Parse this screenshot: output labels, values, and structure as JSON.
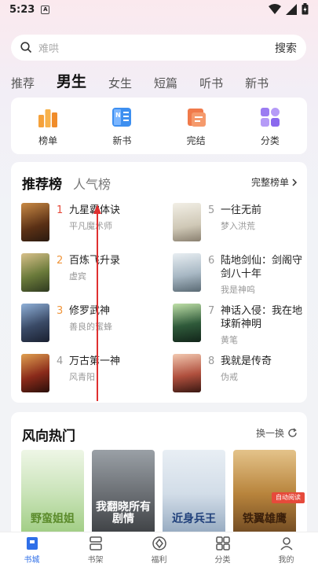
{
  "status": {
    "time": "5:23",
    "notif_badge": "A"
  },
  "search": {
    "placeholder": "难哄",
    "button": "搜索"
  },
  "category_tabs": [
    "推荐",
    "男生",
    "女生",
    "短篇",
    "听书",
    "新书"
  ],
  "quick_entries": [
    {
      "label": "榜单",
      "icon": "ranking-icon"
    },
    {
      "label": "新书",
      "icon": "new-book-icon"
    },
    {
      "label": "完结",
      "icon": "completed-icon"
    },
    {
      "label": "分类",
      "icon": "category-icon"
    }
  ],
  "rank": {
    "tab_active": "推荐榜",
    "tab_inactive": "人气榜",
    "full_list": "完整榜单",
    "items": [
      {
        "num": "1",
        "title": "九星霸体诀",
        "author": "平凡魔术师",
        "cover_color": "#8a5a2b"
      },
      {
        "num": "2",
        "title": "百炼飞升录",
        "author": "虚宾",
        "cover_color": "#5e6f44"
      },
      {
        "num": "3",
        "title": "修罗武神",
        "author": "善良的蜜蜂",
        "cover_color": "#3a4a66"
      },
      {
        "num": "4",
        "title": "万古第一神",
        "author": "风青阳",
        "cover_color": "#6d2a1e"
      },
      {
        "num": "5",
        "title": "一往无前",
        "author": "梦入洪荒",
        "cover_color": "#d9d4c8"
      },
      {
        "num": "6",
        "title": "陆地剑仙：剑阁守剑八十年",
        "author": "我是神呜",
        "cover_color": "#a8b8c4"
      },
      {
        "num": "7",
        "title": "神话入侵：我在地球新神明",
        "author": "黄笔",
        "cover_color": "#2f5a3a"
      },
      {
        "num": "8",
        "title": "我就是传奇",
        "author": "伪戒",
        "cover_color": "#8f4a3e"
      }
    ]
  },
  "trending": {
    "title": "风向热门",
    "refresh": "换一换",
    "covers": [
      {
        "text": "野蛮姐姐",
        "bg": "#c9e3b8",
        "color": "#5a8a2a"
      },
      {
        "text": "我翻晓所有剧情",
        "bg": "#6b6f74",
        "color": "#ffffff"
      },
      {
        "text": "近身兵王",
        "bg": "#d2dde8",
        "color": "#1f3f7a"
      },
      {
        "text": "铁翼雄鹰",
        "bg": "#b8843c",
        "color": "#3a1f0a"
      }
    ],
    "badge": "自动阅读"
  },
  "bottom_nav": [
    {
      "label": "书城",
      "active": true
    },
    {
      "label": "书架",
      "active": false
    },
    {
      "label": "福利",
      "active": false
    },
    {
      "label": "分类",
      "active": false
    },
    {
      "label": "我的",
      "active": false
    }
  ],
  "colors": {
    "accent": "#2f6fe8",
    "rank_hot": "#e64a3b",
    "rank_warm": "#f0953b",
    "arrow": "#e03030"
  }
}
